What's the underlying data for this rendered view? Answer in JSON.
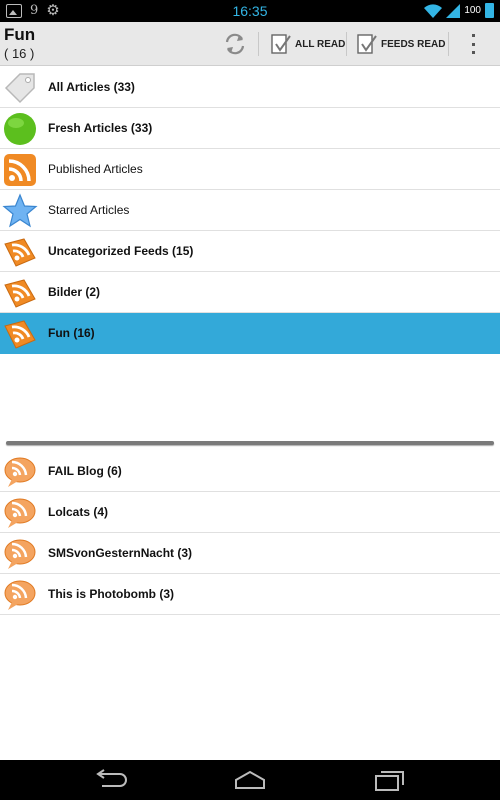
{
  "status_bar": {
    "notif_count": "9",
    "time": "16:35",
    "battery": "100"
  },
  "action_bar": {
    "title": "Fun",
    "subtitle": "( 16 )",
    "all_read_label": "ALL READ",
    "feeds_read_label": "FEEDS READ"
  },
  "categories": [
    {
      "label": "All Articles (33)",
      "icon": "tag-icon"
    },
    {
      "label": "Fresh Articles (33)",
      "icon": "green-circle-icon"
    },
    {
      "label": "Published Articles",
      "icon": "rss-icon"
    },
    {
      "label": "Starred Articles",
      "icon": "star-icon"
    },
    {
      "label": "Uncategorized Feeds (15)",
      "icon": "rss-folder-icon"
    },
    {
      "label": "Bilder (2)",
      "icon": "rss-folder-icon"
    },
    {
      "label": "Fun (16)",
      "icon": "rss-folder-icon",
      "selected": true
    }
  ],
  "feeds": [
    {
      "label": "FAIL Blog (6)",
      "icon": "feed-bubble-icon"
    },
    {
      "label": "Lolcats (4)",
      "icon": "feed-bubble-icon"
    },
    {
      "label": "SMSvonGesternNacht (3)",
      "icon": "feed-bubble-icon"
    },
    {
      "label": "This is Photobomb (3)",
      "icon": "feed-bubble-icon"
    }
  ],
  "colors": {
    "accent": "#33b5e5",
    "selected_row": "#33a9d9",
    "rss_orange": "#f08a24"
  }
}
